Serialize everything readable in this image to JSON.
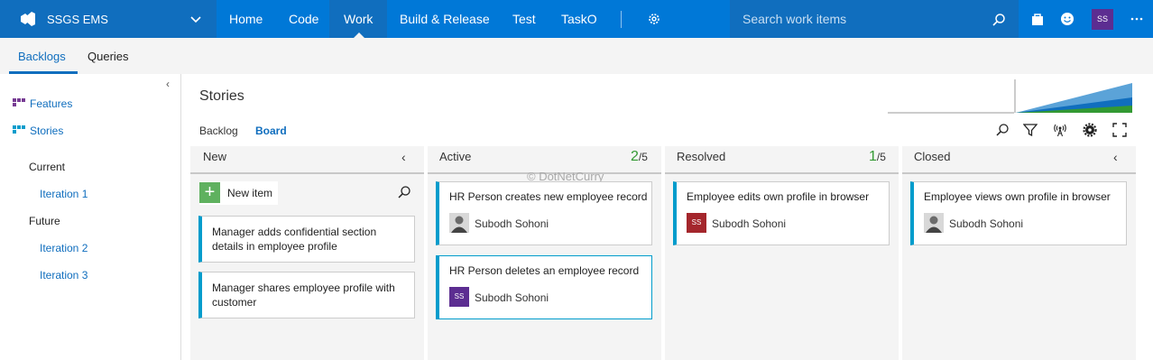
{
  "colors": {
    "accent": "#0078d7",
    "brand_bg": "#106ebe",
    "card_border": "#009ccc",
    "count_ok": "#339933",
    "avatar_purple": "#5c2d91",
    "avatar_red": "#a4262c"
  },
  "topbar": {
    "project": "SSGS EMS",
    "nav": [
      "Home",
      "Code",
      "Work",
      "Build & Release",
      "Test",
      "TaskO"
    ],
    "active_nav": "Work",
    "search_placeholder": "Search work items",
    "user_initials": "SS",
    "icons": [
      "vsts-logo-icon",
      "chevron-down-icon",
      "gear-icon",
      "search-icon",
      "shopping-bag-icon",
      "smiley-icon",
      "more-icon"
    ]
  },
  "subnav": {
    "tabs": [
      "Backlogs",
      "Queries"
    ],
    "active": "Backlogs"
  },
  "sidebar": {
    "backlogs": [
      "Features",
      "Stories"
    ],
    "current_label": "Current",
    "current": [
      "Iteration 1"
    ],
    "future_label": "Future",
    "future": [
      "Iteration 2",
      "Iteration 3"
    ]
  },
  "main": {
    "title": "Stories",
    "view_tabs": [
      "Backlog",
      "Board"
    ],
    "active_view": "Board",
    "watermark": "© DotNetCurry",
    "toolbar_icons": [
      "search-icon",
      "filter-icon",
      "live-updates-icon",
      "settings-icon",
      "fullscreen-icon"
    ],
    "columns": [
      {
        "name": "New",
        "new_item": "New item",
        "cards": [
          {
            "title": "Manager adds confidential section details in employee profile"
          },
          {
            "title": "Manager shares employee profile with customer"
          }
        ]
      },
      {
        "name": "Active",
        "count": "2",
        "limit": "/5",
        "cards": [
          {
            "title": "HR Person creates new employee record",
            "assignee": "Subodh Sohoni",
            "avatar": "photo"
          },
          {
            "title": "HR Person deletes an employee record",
            "assignee": "Subodh Sohoni",
            "avatar": "SS"
          }
        ]
      },
      {
        "name": "Resolved",
        "count": "1",
        "limit": "/5",
        "cards": [
          {
            "title": "Employee edits own profile in browser",
            "assignee": "Subodh Sohoni",
            "avatar": "SS"
          }
        ]
      },
      {
        "name": "Closed",
        "cards": [
          {
            "title": "Employee views own profile in browser",
            "assignee": "Subodh Sohoni",
            "avatar": "photo"
          }
        ]
      }
    ]
  }
}
